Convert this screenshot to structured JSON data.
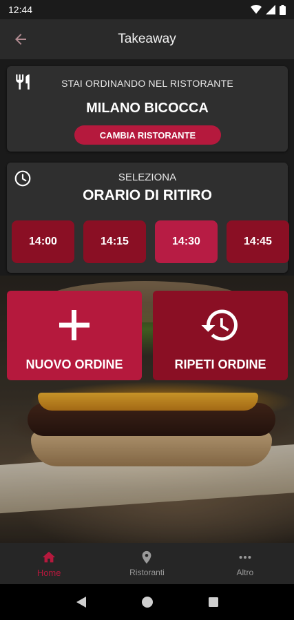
{
  "status_bar": {
    "time": "12:44"
  },
  "app_bar": {
    "title": "Takeaway"
  },
  "restaurant_card": {
    "prefix": "STAI ORDINANDO NEL RISTORANTE",
    "name": "MILANO BICOCCA",
    "change_label": "CAMBIA RISTORANTE"
  },
  "pickup_card": {
    "prefix": "SELEZIONA",
    "title": "ORARIO DI RITIRO",
    "slots": [
      {
        "time": "14:00",
        "selected": false
      },
      {
        "time": "14:15",
        "selected": false
      },
      {
        "time": "14:30",
        "selected": true
      },
      {
        "time": "14:45",
        "selected": false
      }
    ]
  },
  "actions": {
    "new_order": "NUOVO ORDINE",
    "repeat_order": "RIPETI ORDINE"
  },
  "bottom_nav": {
    "items": [
      {
        "label": "Home",
        "icon": "home-icon",
        "active": true
      },
      {
        "label": "Ristoranti",
        "icon": "location-pin-icon",
        "active": false
      },
      {
        "label": "Altro",
        "icon": "more-dots-icon",
        "active": false
      }
    ]
  },
  "colors": {
    "primary": "#b5193d",
    "primary_dark": "#8a0f24",
    "card_bg": "#2f2f2f",
    "app_bar": "#2a2a2a"
  }
}
